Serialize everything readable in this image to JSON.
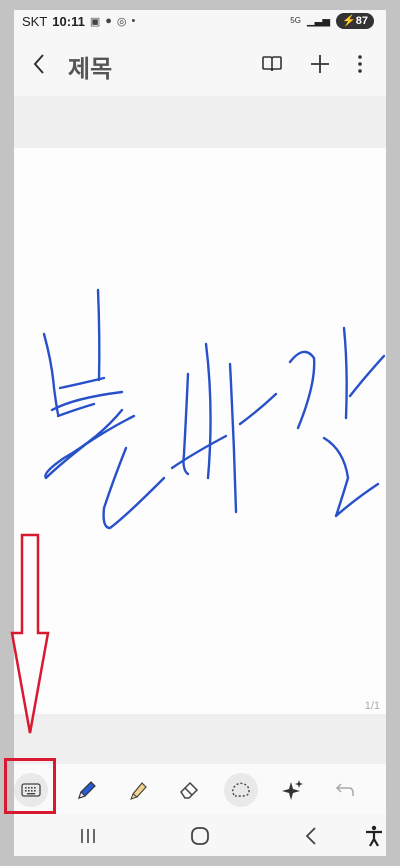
{
  "statusbar": {
    "carrier": "SKT",
    "time": "10:11",
    "network": "5G",
    "battery": "87"
  },
  "appbar": {
    "title": "제목"
  },
  "page": {
    "indicator": "1/1"
  },
  "colors": {
    "ink": "#2851c9",
    "annotation": "#d8192f",
    "toolbar_bg": "#fafafa"
  },
  "toolbar": {
    "tools": [
      "keyboard-icon",
      "pen-icon",
      "highlighter-icon",
      "eraser-icon",
      "lasso-icon",
      "ai-sparkle-icon",
      "undo-icon"
    ]
  }
}
